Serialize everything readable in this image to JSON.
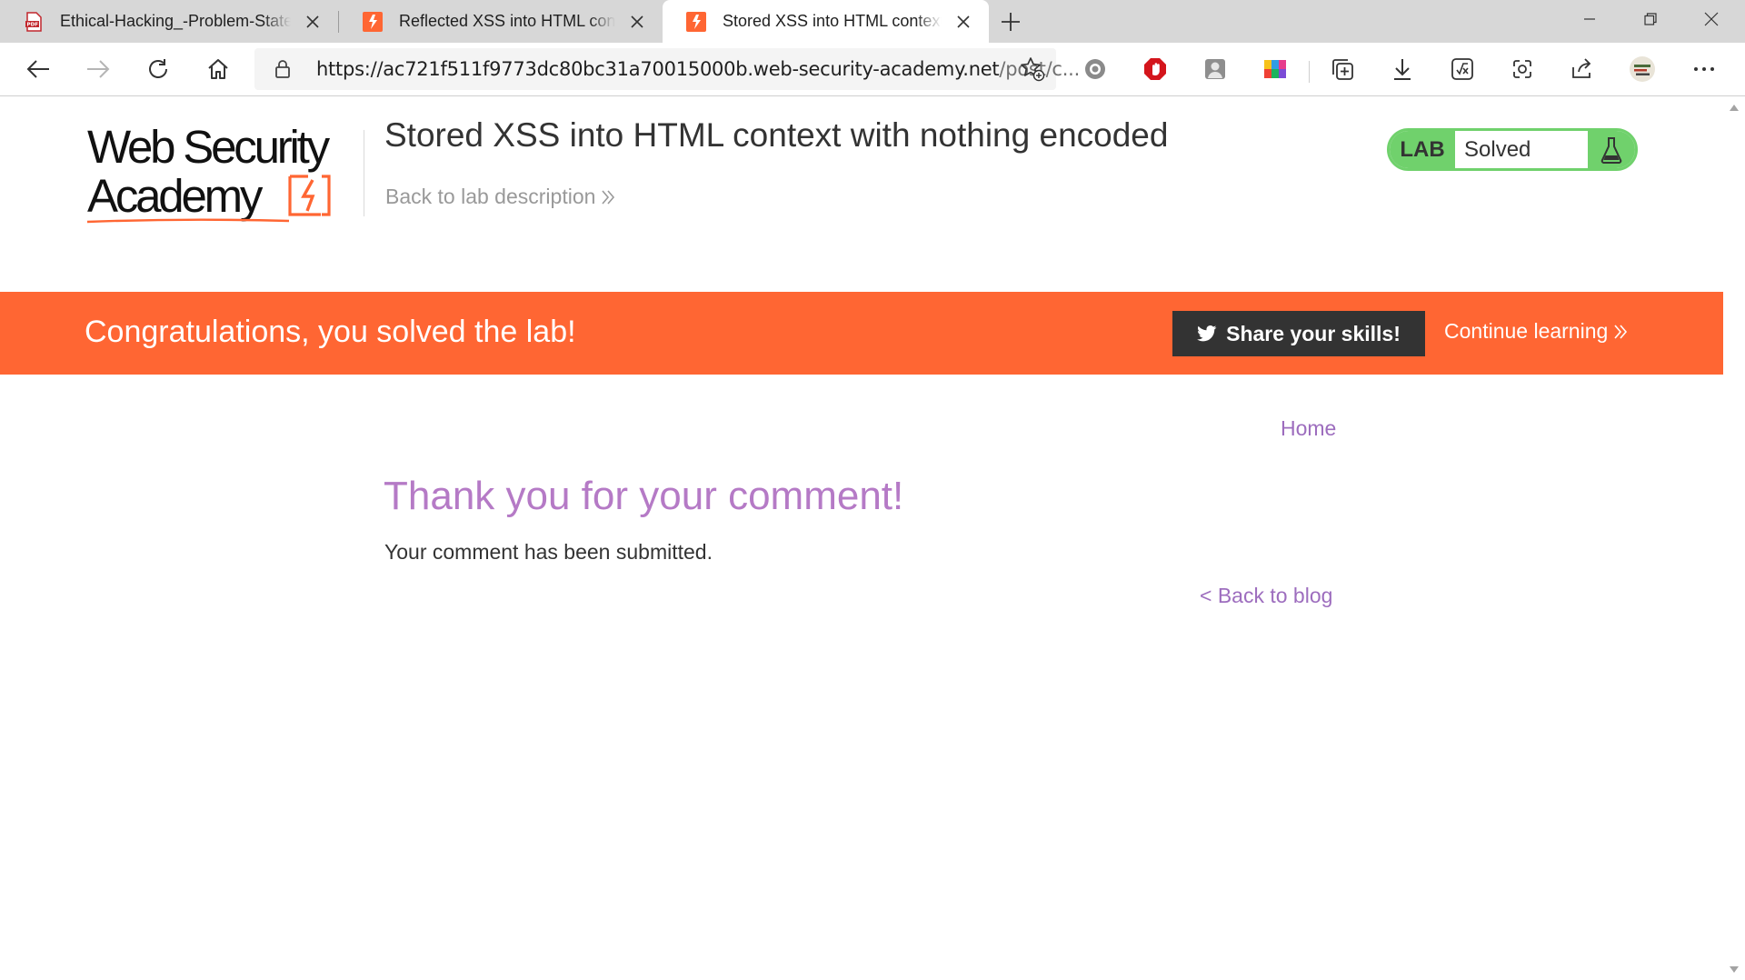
{
  "browser": {
    "tabs": [
      {
        "title": "Ethical-Hacking_-Problem-Statem",
        "icon": "pdf-icon",
        "active": false
      },
      {
        "title": "Reflected XSS into HTML context",
        "icon": "web-security-academy-icon",
        "active": false
      },
      {
        "title": "Stored XSS into HTML context wi",
        "icon": "web-security-academy-icon",
        "active": true
      }
    ],
    "url_host": "https://ac721f511f9773dc80bc31a70015000b.web-security-academy.net",
    "url_path": "/post/c...",
    "toolbar_icons": [
      "back-icon",
      "forward-icon",
      "refresh-icon",
      "home-icon",
      "favorite-add-icon",
      "extension-icon",
      "collections-icon",
      "downloads-icon",
      "math-solver-icon",
      "web-capture-icon",
      "share-icon",
      "profile-icon",
      "more-icon"
    ]
  },
  "header": {
    "logo_line1": "Web Security",
    "logo_line2": "Academy",
    "lab_title": "Stored XSS into HTML context with nothing encoded",
    "back_to_lab": "Back to lab description",
    "lab_tag": "LAB",
    "lab_state": "Solved"
  },
  "banner": {
    "message": "Congratulations, you solved the lab!",
    "share_label": "Share your skills!",
    "continue_label": "Continue learning"
  },
  "content": {
    "nav_home": "Home",
    "heading": "Thank you for your comment!",
    "message": "Your comment has been submitted.",
    "back_to_blog": "< Back to blog"
  },
  "colors": {
    "accent_orange": "#ff6633",
    "lab_green": "#70d16c",
    "link_purple": "#9d6dbe",
    "heading_purple": "#b57ac6",
    "share_button": "#333333"
  }
}
